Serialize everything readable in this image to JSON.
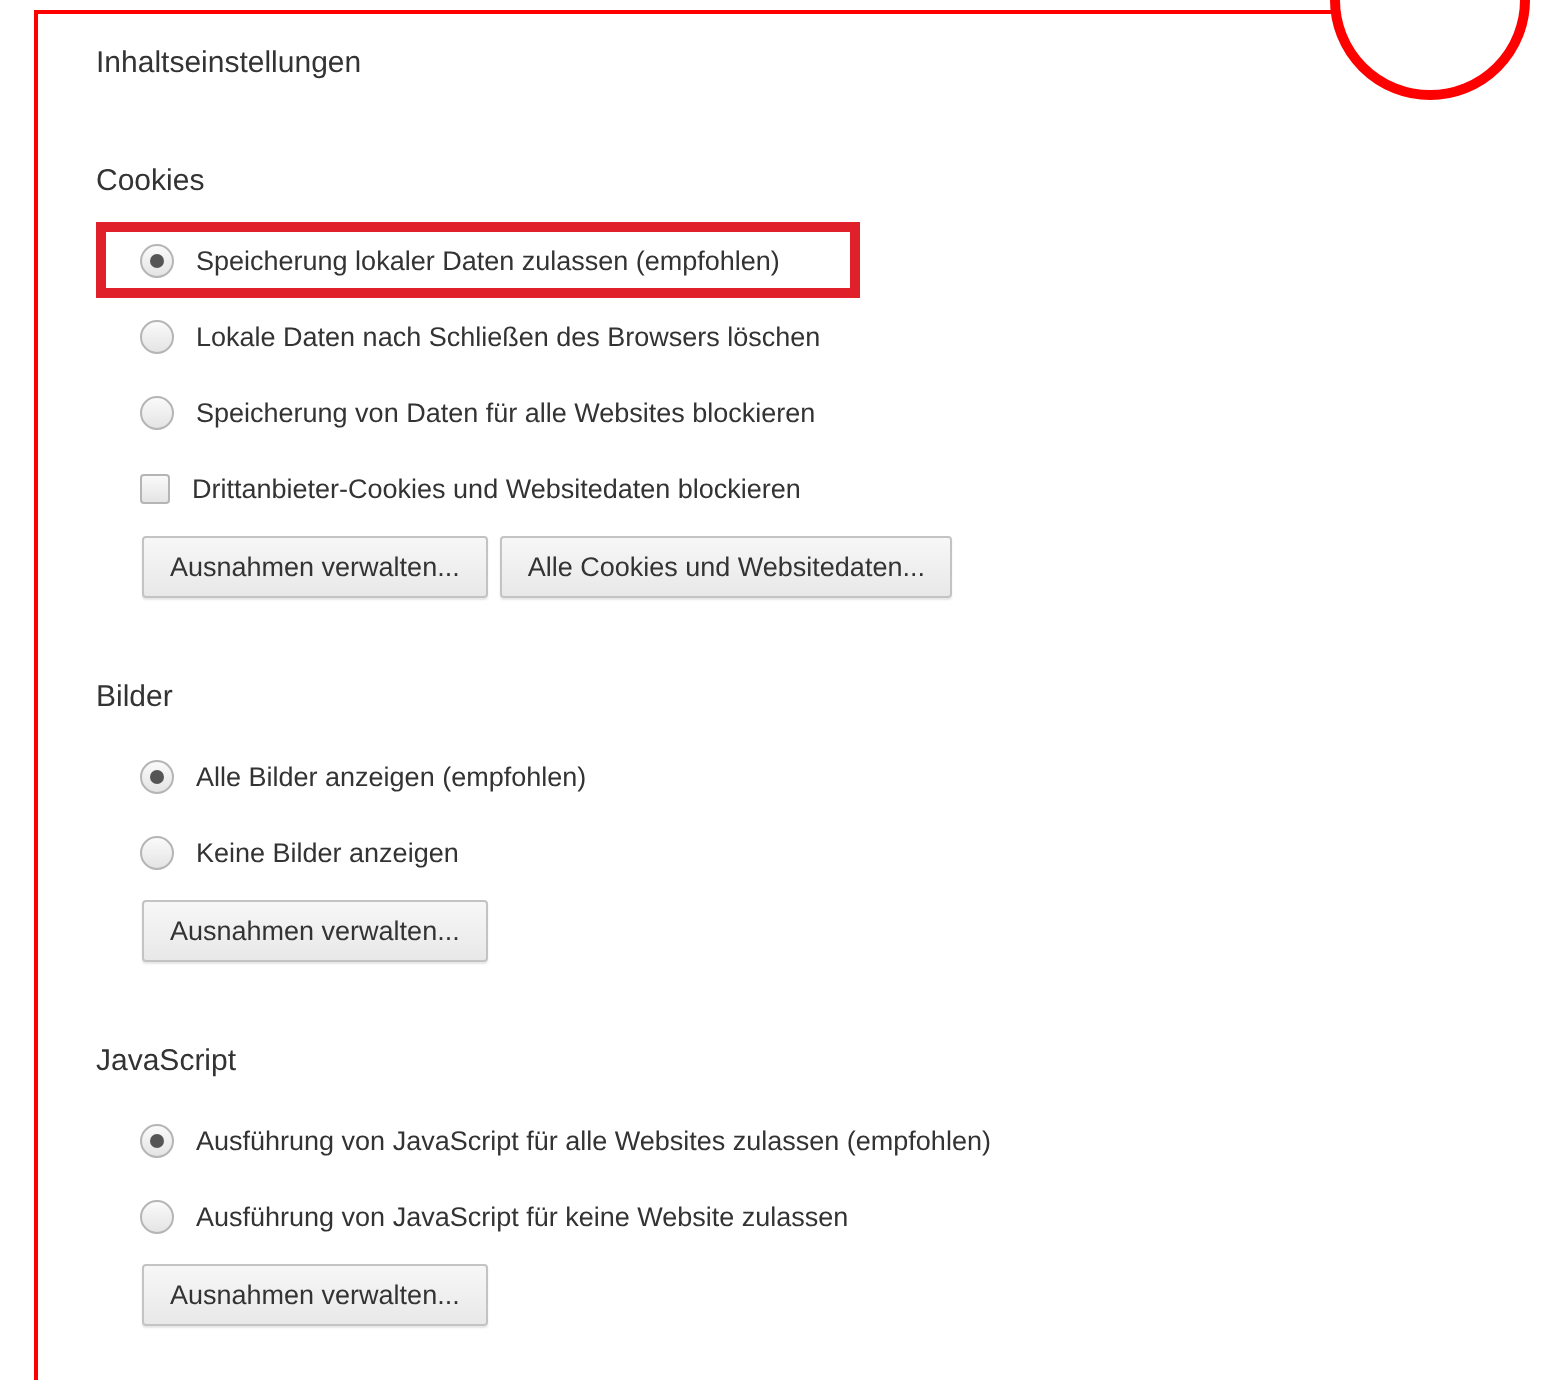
{
  "title": "Inhaltseinstellungen",
  "sections": [
    {
      "heading": "Cookies",
      "options": [
        {
          "kind": "radio",
          "label": "Speicherung lokaler Daten zulassen (empfohlen)",
          "selected": true,
          "highlighted": true
        },
        {
          "kind": "radio",
          "label": "Lokale Daten nach Schließen des Browsers löschen",
          "selected": false,
          "highlighted": false
        },
        {
          "kind": "radio",
          "label": "Speicherung von Daten für alle Websites blockieren",
          "selected": false,
          "highlighted": false
        },
        {
          "kind": "checkbox",
          "label": "Drittanbieter-Cookies und Websitedaten blockieren",
          "checked": false,
          "highlighted": false
        }
      ],
      "buttons": [
        "Ausnahmen verwalten...",
        "Alle Cookies und Websitedaten..."
      ]
    },
    {
      "heading": "Bilder",
      "options": [
        {
          "kind": "radio",
          "label": "Alle Bilder anzeigen (empfohlen)",
          "selected": true,
          "highlighted": false
        },
        {
          "kind": "radio",
          "label": "Keine Bilder anzeigen",
          "selected": false,
          "highlighted": false
        }
      ],
      "buttons": [
        "Ausnahmen verwalten..."
      ]
    },
    {
      "heading": "JavaScript",
      "options": [
        {
          "kind": "radio",
          "label": "Ausführung von JavaScript für alle Websites zulassen (empfohlen)",
          "selected": true,
          "highlighted": false
        },
        {
          "kind": "radio",
          "label": "Ausführung von JavaScript für keine Website zulassen",
          "selected": false,
          "highlighted": false
        }
      ],
      "buttons": [
        "Ausnahmen verwalten..."
      ]
    }
  ]
}
